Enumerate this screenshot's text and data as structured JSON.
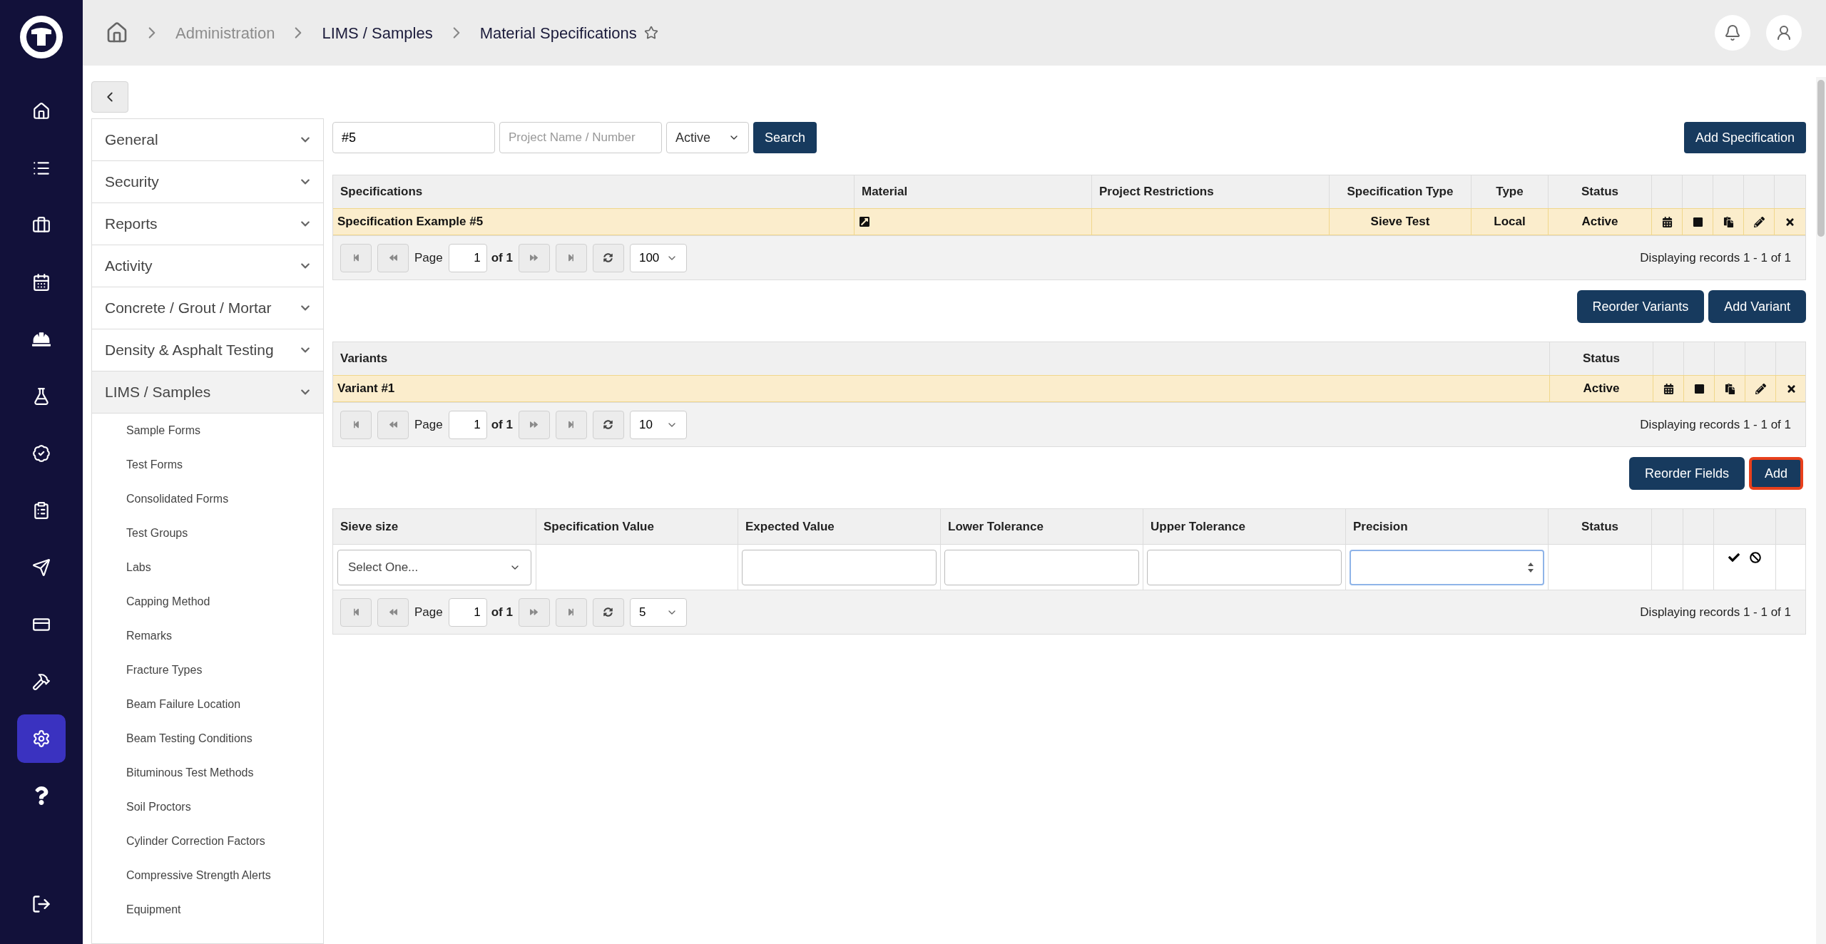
{
  "rail": {
    "items": [
      {
        "selected": false
      },
      {
        "selected": false
      },
      {
        "selected": false
      },
      {
        "selected": false
      },
      {
        "selected": false
      },
      {
        "selected": false
      },
      {
        "selected": false
      },
      {
        "selected": false
      },
      {
        "selected": false
      },
      {
        "selected": false
      },
      {
        "selected": false
      },
      {
        "selected": true
      },
      {
        "selected": false
      }
    ]
  },
  "breadcrumb": [
    {
      "label": "Administration",
      "muted": true
    },
    {
      "label": "LIMS / Samples",
      "muted": false
    },
    {
      "label": "Material Specifications",
      "muted": false
    }
  ],
  "sidebar": {
    "sections": [
      {
        "label": "General",
        "expanded": false
      },
      {
        "label": "Security",
        "expanded": false
      },
      {
        "label": "Reports",
        "expanded": false
      },
      {
        "label": "Activity",
        "expanded": false
      },
      {
        "label": "Concrete / Grout / Mortar",
        "expanded": false
      },
      {
        "label": "Density & Asphalt Testing",
        "expanded": false
      },
      {
        "label": "LIMS / Samples",
        "expanded": true,
        "children": [
          "Sample Forms",
          "Test Forms",
          "Consolidated Forms",
          "Test Groups",
          "Labs",
          "Capping Method",
          "Remarks",
          "Fracture Types",
          "Beam Failure Location",
          "Beam Testing Conditions",
          "Bituminous Test Methods",
          "Soil Proctors",
          "Cylinder Correction Factors",
          "Compressive Strength Alerts",
          "Equipment"
        ]
      }
    ]
  },
  "filters": {
    "search_value": "#5",
    "project_placeholder": "Project Name / Number",
    "status": "Active",
    "search_button": "Search",
    "add_button": "Add Specification"
  },
  "specifications": {
    "columns": [
      "Specifications",
      "Material",
      "Project Restrictions",
      "Specification Type",
      "Type",
      "Status"
    ],
    "rows": [
      {
        "selected": true,
        "cells": [
          "Specification Example #5",
          "",
          "",
          "Sieve Test",
          "Local",
          "Active"
        ]
      }
    ],
    "pager": {
      "page_label": "Page",
      "page": "1",
      "of": "of 1",
      "page_size": "100",
      "summary": "Displaying records 1 - 1 of 1"
    }
  },
  "variant_buttons": [
    {
      "label": "Reorder Variants",
      "highlighted": false
    },
    {
      "label": "Add Variant",
      "highlighted": false
    }
  ],
  "variants": {
    "columns": [
      "Variants",
      "Status"
    ],
    "rows": [
      {
        "selected": true,
        "cells": [
          "Variant #1",
          "Active"
        ]
      }
    ],
    "pager": {
      "page_label": "Page",
      "page": "1",
      "of": "of 1",
      "page_size": "10",
      "summary": "Displaying records 1 - 1 of 1"
    }
  },
  "field_buttons": [
    {
      "label": "Reorder Fields",
      "highlighted": false
    },
    {
      "label": "Add",
      "highlighted": true
    }
  ],
  "fields": {
    "columns": [
      "Sieve size",
      "Specification Value",
      "Expected Value",
      "Lower Tolerance",
      "Upper Tolerance",
      "Precision",
      "Status"
    ],
    "edit_row": {
      "sieve_select": "Select One...",
      "inputs": [
        {
          "focused": false
        },
        {
          "focused": false
        },
        {
          "focused": false
        },
        {
          "focused": true
        }
      ]
    },
    "pager": {
      "page_label": "Page",
      "page": "1",
      "of": "of 1",
      "page_size": "5",
      "summary": "Displaying records 1 - 1 of 1"
    }
  }
}
